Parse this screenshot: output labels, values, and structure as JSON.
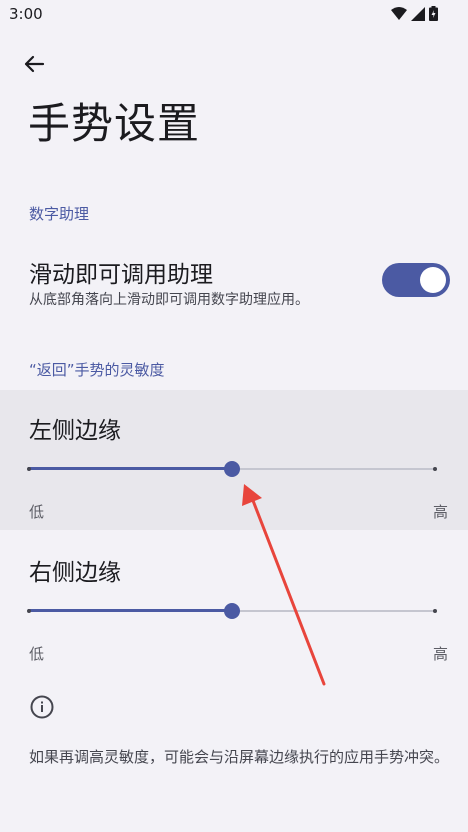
{
  "status_bar": {
    "time": "3:00"
  },
  "page": {
    "title": "手势设置"
  },
  "digital_assistant": {
    "section_header": "数字助理",
    "title": "滑动即可调用助理",
    "summary": "从底部角落向上滑动即可调用数字助理应用。",
    "enabled": true
  },
  "back_sensitivity": {
    "section_header": "“返回”手势的灵敏度",
    "left_edge": {
      "title": "左侧边缘",
      "low_label": "低",
      "high_label": "高",
      "value_fraction": 0.5
    },
    "right_edge": {
      "title": "右侧边缘",
      "low_label": "低",
      "high_label": "高",
      "value_fraction": 0.5
    }
  },
  "footer": {
    "icon": "info-icon",
    "text": "如果再调高灵敏度，可能会与沿屏幕边缘执行的应用手势冲突。"
  },
  "colors": {
    "accent": "#4b5aa3",
    "background": "#f3f2f7",
    "highlight": "#e8e7ec",
    "annotation": "#e8453c"
  }
}
